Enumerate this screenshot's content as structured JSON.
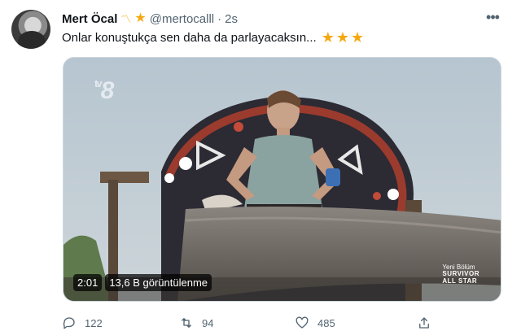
{
  "author": {
    "name": "Mert Öcal",
    "name_badge_icons": [
      "wave-icon",
      "star-icon"
    ],
    "handle": "@mertocalll",
    "separator": "·",
    "time": "2s"
  },
  "tweet": {
    "text": "Onlar konuştukça sen daha da parlayacaksın...",
    "trailing_emoji": "★★★"
  },
  "media": {
    "type": "video",
    "channel_logo": "tv8",
    "channel_logo_prefix": "tv",
    "channel_logo_number": "8",
    "show_episode": "Yeni Bölüm",
    "show_name_line1": "SURVIVOR",
    "show_name_line2": "ALL STAR",
    "duration": "2:01",
    "views": "13,6 B görüntülenme"
  },
  "actions": {
    "replies": "122",
    "retweets": "94",
    "likes": "485"
  },
  "colors": {
    "accent_star": "#f4a810",
    "muted_text": "#536471",
    "primary_text": "#0f1419"
  }
}
